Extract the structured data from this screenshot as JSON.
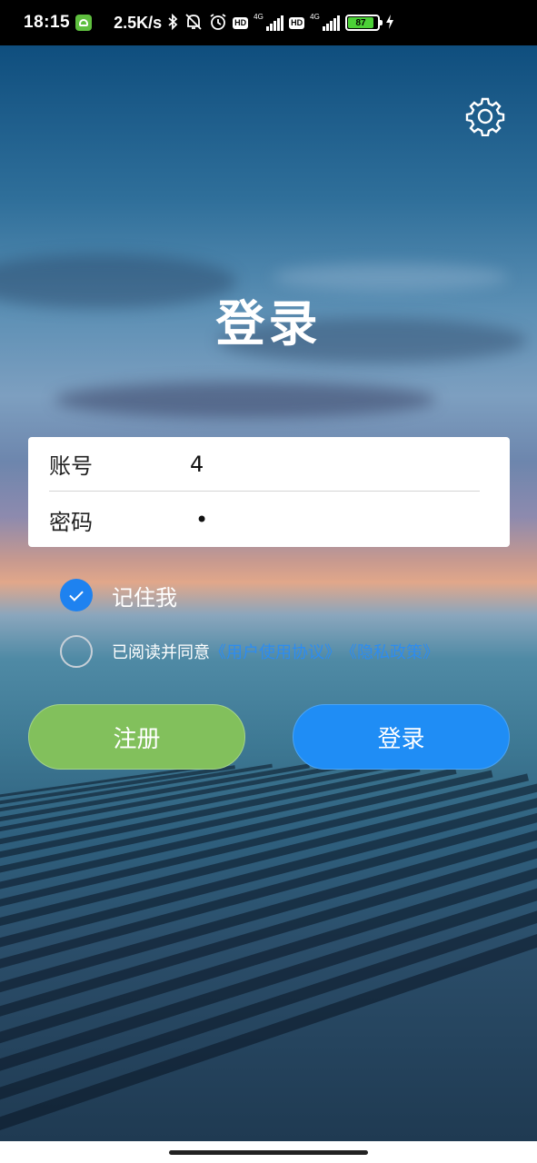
{
  "status_bar": {
    "time": "18:15",
    "net_speed": "2.5K/s",
    "hd1": "HD",
    "hd2": "HD",
    "net1": "4G",
    "net2": "4G",
    "battery": "87",
    "battery_level": 0.87,
    "icons": [
      "app-notification-icon",
      "bluetooth-icon",
      "mute-icon",
      "alarm-icon",
      "hd-icon",
      "signal-icon",
      "hd-icon",
      "signal-icon",
      "battery-icon",
      "charging-icon"
    ]
  },
  "header": {
    "settings_icon": "gear-icon",
    "title": "登录"
  },
  "form": {
    "account_label": "账号",
    "account_value": "4",
    "password_label": "密码",
    "password_value": "•"
  },
  "options": {
    "remember_label": "记住我",
    "remember_checked": true,
    "agree_prefix": "已阅读并同意",
    "user_agreement_link": "《用户使用协议》",
    "privacy_policy_link": "《隐私政策》",
    "agree_checked": false
  },
  "buttons": {
    "register_label": "注册",
    "login_label": "登录",
    "register_color": "#82c05c",
    "login_color": "#1f8df5"
  },
  "colors": {
    "accent": "#1e82f0",
    "link": "#2d8cf0"
  }
}
